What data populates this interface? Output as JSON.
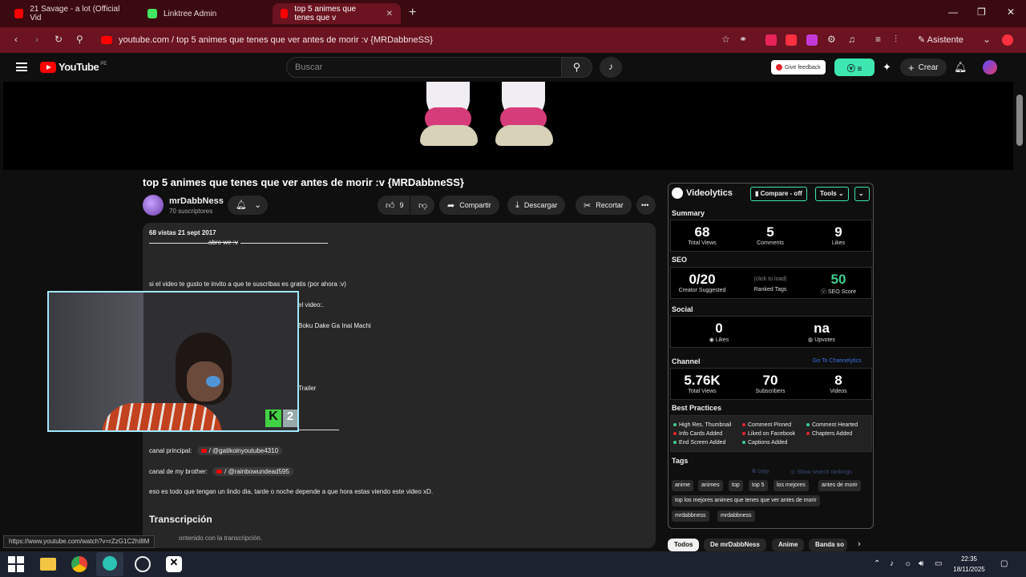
{
  "browser": {
    "tabs": [
      {
        "label": "21 Savage - a lot (Official Vid",
        "color": "#ff0000",
        "active": false
      },
      {
        "label": "Linktree Admin",
        "color": "#43e660",
        "active": false
      },
      {
        "label": "top 5 animes que tenes que v",
        "color": "#ff0000",
        "active": true
      }
    ],
    "url": "youtube.com / top 5 animes que tenes que ver antes de morir :v {MRDabbneSS}",
    "assistant_label": "Asistente",
    "window_controls": [
      "—",
      "❐",
      "✕"
    ]
  },
  "youtube": {
    "logo": "YouTube",
    "country": "PE",
    "search_placeholder": "Buscar",
    "feedback_label": "Give feedback",
    "create_label": "Crear"
  },
  "video": {
    "title": "top 5 animes que tenes que ver antes de morir :v {MRDabbneSS}",
    "channel": "mrDabbNess",
    "subscribers": "70 suscriptores",
    "likes": "9",
    "share_label": "Compartir",
    "download_label": "Descargar",
    "clip_label": "Recortar"
  },
  "description": {
    "meta": "68 vistas  21 sept 2017",
    "open": "abre we :v",
    "line1": "si el video te gusto te invito a que te suscribas es gratis (por ahora :v)",
    "line2": "el video:.",
    "line3": "Boku Dake Ga Inai Machi",
    "line4": "Trailer",
    "main_prefix": "canal principal:",
    "main_handle": "/ @gatikoinyoutube4310",
    "brother_prefix": "canal de my brother:",
    "brother_handle": "/ @rainbowundead595",
    "closing": "eso es todo que tengan un lindo dia, tarde o noche depende a que hora estas viendo este video xD.",
    "transcription_title": "Transcripción",
    "transcription_note": "ontenido con la transcripción."
  },
  "status_url": "https://www.youtube.com/watch?v=rZzG1C2hI8M",
  "videolytics": {
    "brand": "Videolytics",
    "compare_label": "Compare - off",
    "tools_label": "Tools",
    "summary_title": "Summary",
    "summary": [
      {
        "value": "68",
        "label": "Total Views"
      },
      {
        "value": "5",
        "label": "Comments"
      },
      {
        "value": "9",
        "label": "Likes"
      }
    ],
    "seo_title": "SEO",
    "seo_creator_value": "0/20",
    "seo_creator_label": "Creator Suggested",
    "seo_click": "(click to load)",
    "seo_ranked_label": "Ranked Tags",
    "seo_score_value": "50",
    "seo_score_label": "SEO Score",
    "seo_score_color": "#3ecf8e",
    "social_title": "Social",
    "social_likes_value": "0",
    "social_likes_label": "Likes",
    "social_upvotes_value": "na",
    "social_upvotes_label": "Upvotes",
    "channel_title": "Channel",
    "channel_link": "Go To Channelytics",
    "channel_stats": [
      {
        "value": "5.76K",
        "label": "Total Views"
      },
      {
        "value": "70",
        "label": "Subscribers"
      },
      {
        "value": "8",
        "label": "Videos"
      }
    ],
    "best_title": "Best Practices",
    "best": [
      {
        "text": "High Res. Thumbnail",
        "ok": true
      },
      {
        "text": "Comment Pinned",
        "ok": false
      },
      {
        "text": "Comment Hearted",
        "ok": true
      },
      {
        "text": "Info Cards Added",
        "ok": false
      },
      {
        "text": "Liked on Facebook",
        "ok": false
      },
      {
        "text": "Chapters Added",
        "ok": false
      },
      {
        "text": "End Screen Added",
        "ok": true
      },
      {
        "text": "Captions Added",
        "ok": true
      }
    ],
    "tags_title": "Tags",
    "copy_label": "copy",
    "rankings_label": "Show search rankings",
    "tags": [
      "anime",
      "animes",
      "top",
      "top 5",
      "los mejores",
      "antes de morir",
      "top los mejores animes que tenes que ver antes de morir",
      "mrdabbness",
      "mrdabbness"
    ]
  },
  "bottom_chips": [
    "Todos",
    "De mrDabbNess",
    "Anime",
    "Banda so"
  ],
  "taskbar": {
    "time": "22:35",
    "date": "18/11/2025"
  }
}
